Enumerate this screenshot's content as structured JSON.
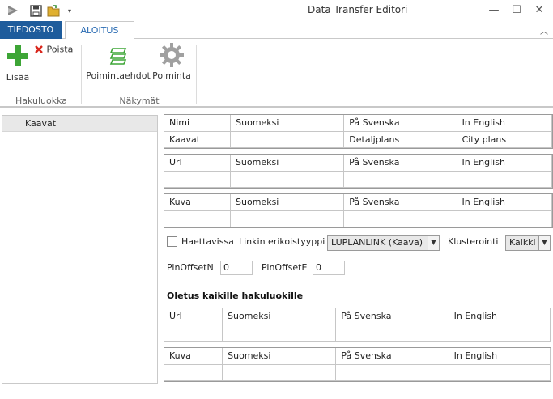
{
  "window": {
    "title": "Data Transfer Editori",
    "minimize_glyph": "—",
    "maximize_glyph": "☐",
    "close_glyph": "✕"
  },
  "ribbon_tabs": {
    "file": "TIEDOSTO",
    "home": "ALOITUS",
    "collapse_glyph": "︿"
  },
  "ribbon": {
    "add_label": "Lisää",
    "remove_label": "Poista",
    "criteria_label": "Poimintaehdot",
    "extract_label": "Poiminta",
    "group1_label": "Hakuluokka",
    "group2_label": "Näkymät",
    "colors": {
      "add": "#3da536",
      "remove": "#d9261c",
      "criteria": "#3da536",
      "gear": "#9a9a9a"
    }
  },
  "left_panel": {
    "items": [
      {
        "label": "Kaavat"
      }
    ]
  },
  "grids": {
    "name": {
      "headers": [
        "Nimi",
        "Suomeksi",
        "På Svenska",
        "In English"
      ],
      "row": [
        "Kaavat",
        "",
        "Detaljplans",
        "City plans"
      ]
    },
    "url": {
      "headers": [
        "Url",
        "Suomeksi",
        "På Svenska",
        "In English"
      ],
      "row": [
        "",
        "",
        "",
        ""
      ]
    },
    "image": {
      "headers": [
        "Kuva",
        "Suomeksi",
        "På Svenska",
        "In English"
      ],
      "row": [
        "",
        "",
        "",
        ""
      ]
    }
  },
  "options": {
    "hidden_label": "Haettavissa",
    "hidden_checked": false,
    "link_type_label": "Linkin erikoistyyppi",
    "link_type_value": "LUPLANLINK (Kaava)",
    "clustering_label": "Klusterointi",
    "clustering_value": "Kaikki",
    "pin_offset_n_label": "PinOffsetN",
    "pin_offset_n_value": "0",
    "pin_offset_e_label": "PinOffsetE",
    "pin_offset_e_value": "0",
    "dropdown_arrow": "▼"
  },
  "defaults": {
    "title": "Oletus kaikille hakuluokille",
    "url": {
      "headers": [
        "Url",
        "Suomeksi",
        "På Svenska",
        "In English"
      ],
      "row": [
        "",
        "",
        "",
        ""
      ]
    },
    "image": {
      "headers": [
        "Kuva",
        "Suomeksi",
        "På Svenska",
        "In English"
      ],
      "row": [
        "",
        "",
        "",
        ""
      ]
    }
  }
}
